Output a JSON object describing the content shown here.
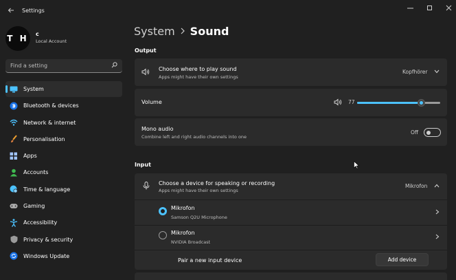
{
  "window": {
    "title": "Settings"
  },
  "profile": {
    "avatar_initials": "T H",
    "name": "c",
    "account_type": "Local Account"
  },
  "search": {
    "placeholder": "Find a setting"
  },
  "sidebar": {
    "items": [
      {
        "label": "System",
        "icon": "monitor-icon",
        "active": true
      },
      {
        "label": "Bluetooth & devices",
        "icon": "bluetooth-icon"
      },
      {
        "label": "Network & internet",
        "icon": "wifi-icon"
      },
      {
        "label": "Personalisation",
        "icon": "brush-icon"
      },
      {
        "label": "Apps",
        "icon": "apps-icon"
      },
      {
        "label": "Accounts",
        "icon": "person-icon"
      },
      {
        "label": "Time & language",
        "icon": "globe-clock-icon"
      },
      {
        "label": "Gaming",
        "icon": "gamepad-icon"
      },
      {
        "label": "Accessibility",
        "icon": "accessibility-icon"
      },
      {
        "label": "Privacy & security",
        "icon": "shield-icon"
      },
      {
        "label": "Windows Update",
        "icon": "update-icon"
      }
    ]
  },
  "breadcrumb": {
    "parent": "System",
    "current": "Sound"
  },
  "output": {
    "heading": "Output",
    "choose_device": {
      "title": "Choose where to play sound",
      "subtitle": "Apps might have their own settings",
      "selected": "Kopfhörer"
    },
    "volume": {
      "label": "Volume",
      "value": "77",
      "level": 0.77
    },
    "mono_audio": {
      "title": "Mono audio",
      "subtitle": "Combine left and right audio channels into one",
      "state": "Off"
    }
  },
  "input": {
    "heading": "Input",
    "choose_device": {
      "title": "Choose a device for speaking or recording",
      "subtitle": "Apps might have their own settings",
      "selected": "Mikrofon"
    },
    "devices": [
      {
        "name": "Mikrofon",
        "detail": "Samson Q2U Microphone",
        "selected": true
      },
      {
        "name": "Mikrofon",
        "detail": "NVIDIA Broadcast",
        "selected": false
      }
    ],
    "pair": {
      "label": "Pair a new input device",
      "button": "Add device"
    }
  },
  "colors": {
    "accent": "#4cc2ff",
    "background": "#202020",
    "card": "#2b2b2b"
  }
}
